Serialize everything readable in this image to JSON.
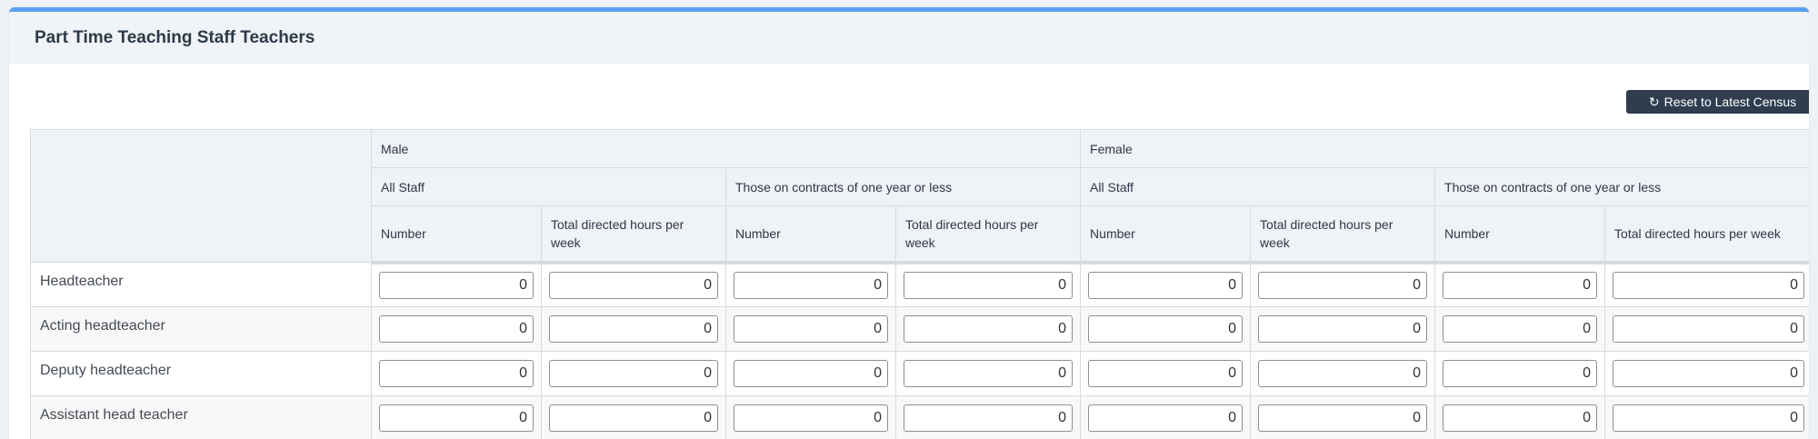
{
  "panel": {
    "title": "Part Time Teaching Staff Teachers",
    "reset_button": {
      "label": "Reset to Latest Census",
      "icon": "refresh-icon"
    }
  },
  "table": {
    "groups": [
      "Male",
      "Female"
    ],
    "subgroups": [
      "All Staff",
      "Those on contracts of one year or less",
      "All Staff",
      "Those on contracts of one year or less"
    ],
    "columns": [
      "Number",
      "Total directed hours per week",
      "Number",
      "Total directed hours per week",
      "Number",
      "Total directed hours per week",
      "Number",
      "Total directed hours per week"
    ],
    "rows": [
      {
        "label": "Headteacher",
        "values": [
          "0",
          "0",
          "0",
          "0",
          "0",
          "0",
          "0",
          "0"
        ]
      },
      {
        "label": "Acting headteacher",
        "values": [
          "0",
          "0",
          "0",
          "0",
          "0",
          "0",
          "0",
          "0"
        ]
      },
      {
        "label": "Deputy headteacher",
        "values": [
          "0",
          "0",
          "0",
          "0",
          "0",
          "0",
          "0",
          "0"
        ]
      },
      {
        "label": "Assistant head teacher",
        "values": [
          "0",
          "0",
          "0",
          "0",
          "0",
          "0",
          "0",
          "0"
        ]
      }
    ]
  },
  "colors": {
    "accent": "#5b9ff0",
    "button_bg": "#2f3d4f",
    "header_bg": "#f0f3f7"
  }
}
